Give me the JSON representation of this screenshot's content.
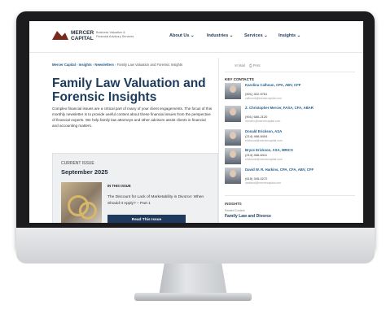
{
  "header": {
    "logo_name": "MERCER CAPITAL",
    "logo_tagline": "Business Valuation & Financial Advisory Services",
    "nav": [
      {
        "label": "About Us ⌄"
      },
      {
        "label": "Industries ⌄"
      },
      {
        "label": "Services ⌄"
      },
      {
        "label": "Insights ⌄"
      }
    ]
  },
  "breadcrumb": {
    "items": [
      "Mercer Capital",
      "Insights",
      "Newsletters"
    ],
    "separator": "›",
    "current": "Family Law Valuation and Forensic Insights"
  },
  "page": {
    "title": "Family Law Valuation and Forensic Insights",
    "intro": "Complex financial issues are a critical part of many of your client engagements. The focus of this monthly newsletter is to provide useful content about these financial issues from the perspective of financial experts. We help family law attorneys and other advisors assist clients in financial and accounting matters."
  },
  "issue": {
    "label": "CURRENT ISSUE",
    "date": "September 2025",
    "in_this_issue": "IN THIS ISSUE",
    "article": "The Discount for Lack of Marketability in Divorce: When Should It Apply? – Part 1",
    "button": "Read This Issue"
  },
  "share": {
    "email": "✉ Mail",
    "print": "⎙ Print"
  },
  "contacts": {
    "heading": "KEY CONTACTS",
    "items": [
      {
        "name": "Karolina Calhoun, CPA, ABV, CFF",
        "phone": "(901) 322-9761",
        "email": "calhounk@mercercapital.com"
      },
      {
        "name": "Z. Christopher Mercer, FASA, CFA, ABAR",
        "phone": "(901) 685-2120",
        "email": "mercerc@mercercapital.com"
      },
      {
        "name": "Donald Erickson, ASA",
        "phone": "(214) 468-8404",
        "email": "ericksond@mercercapital.com"
      },
      {
        "name": "Bryce Erickson, ASA, MRICS",
        "phone": "(214) 468-8411",
        "email": "ericksonb@mercercapital.com"
      },
      {
        "name": "David W. R. Harkins, CPA, CFA, ABV, CFF",
        "phone": "(615) 345-0272",
        "email": "harkinsd@mercercapital.com"
      }
    ]
  },
  "insights": {
    "heading": "INSIGHTS",
    "sub": "Related Content",
    "link": "Family Law and Divorce"
  }
}
